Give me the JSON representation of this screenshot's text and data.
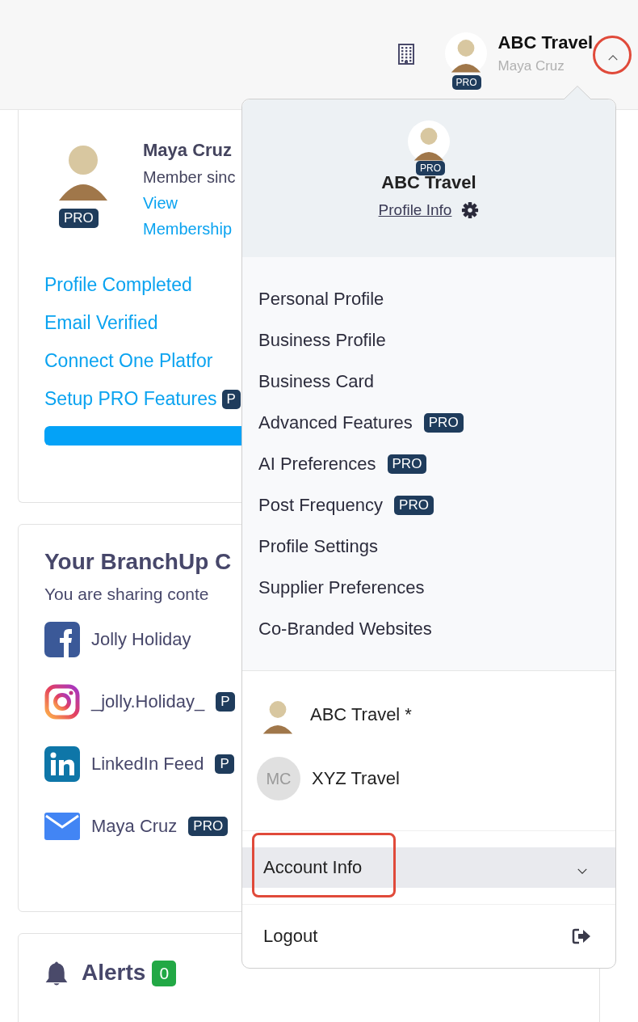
{
  "header": {
    "account": {
      "name": "ABC Travel",
      "user": "Maya Cruz",
      "badge": "PRO"
    },
    "toggle": {
      "expanded": true,
      "highlighted": true
    }
  },
  "profile_card": {
    "name": "Maya Cruz",
    "badge": "PRO",
    "member_since": "Member sinc",
    "links": [
      "View",
      "Membership"
    ],
    "checklist": [
      {
        "label": "Profile Completed"
      },
      {
        "label": "Email Verified"
      },
      {
        "label": "Connect One Platfor"
      },
      {
        "label": "Setup PRO Features",
        "badge": "P"
      }
    ],
    "progress": {
      "level": 1
    }
  },
  "channels_card": {
    "title": "Your BranchUp C",
    "subtitle": "You are sharing conte",
    "channels": [
      {
        "kind": "facebook",
        "name": "Jolly Holiday"
      },
      {
        "kind": "instagram",
        "name": "_jolly.Holiday_",
        "badge": "P"
      },
      {
        "kind": "linkedin",
        "name": "LinkedIn Feed",
        "badge": "P"
      },
      {
        "kind": "email",
        "name": "Maya Cruz",
        "badge": "PRO"
      }
    ]
  },
  "alerts_card": {
    "title": "Alerts",
    "count": "0"
  },
  "dropdown": {
    "account": {
      "badge": "PRO",
      "name": "ABC Travel",
      "profile_link": "Profile Info"
    },
    "menu": [
      {
        "label": "Personal Profile"
      },
      {
        "label": "Business Profile"
      },
      {
        "label": "Business Card"
      },
      {
        "label": "Advanced Features",
        "badge": "PRO"
      },
      {
        "label": "AI Preferences",
        "badge": "PRO"
      },
      {
        "label": "Post Frequency",
        "badge": "PRO"
      },
      {
        "label": "Profile Settings"
      },
      {
        "label": "Supplier Preferences"
      },
      {
        "label": "Co-Branded Websites"
      }
    ],
    "accounts": [
      {
        "kind": "photo",
        "name": "ABC Travel *"
      },
      {
        "kind": "initials",
        "initials": "MC",
        "name": "XYZ Travel"
      }
    ],
    "account_info": {
      "label": "Account Info",
      "expanded": false,
      "highlighted": true
    },
    "logout": "Logout"
  }
}
